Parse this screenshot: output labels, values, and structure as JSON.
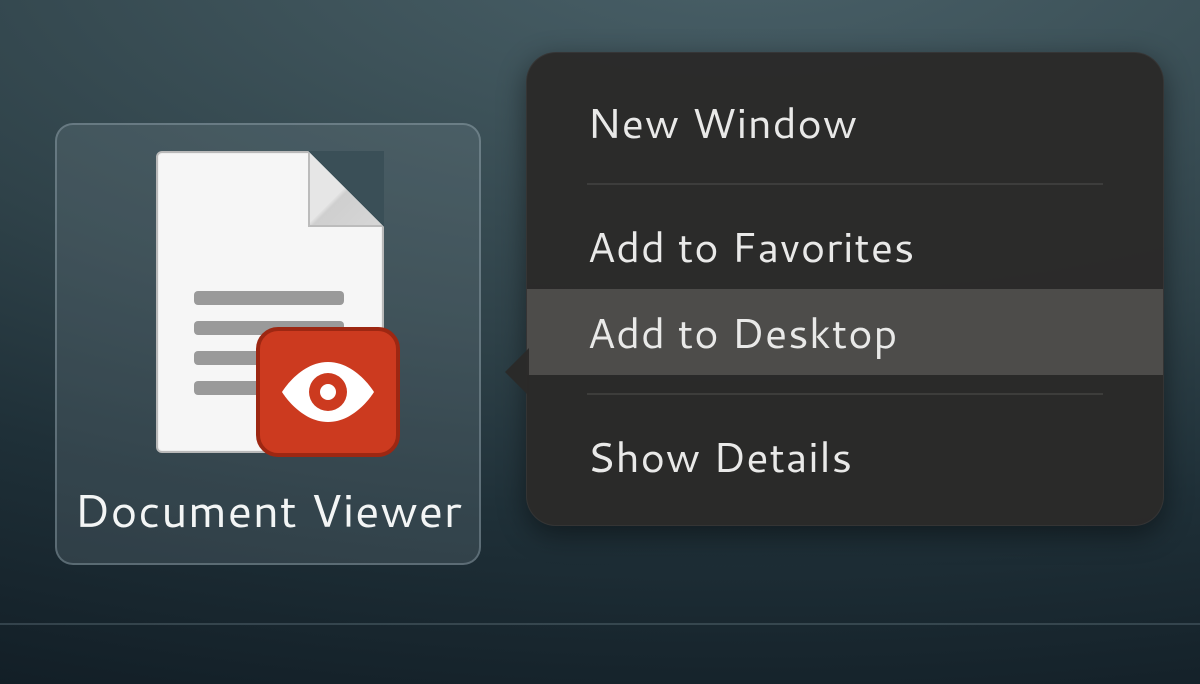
{
  "app": {
    "label": "Document Viewer",
    "icon_name": "document-viewer-icon"
  },
  "menu": {
    "items": [
      {
        "label": "New Window"
      },
      {
        "label": "Add to Favorites"
      },
      {
        "label": "Add to Desktop",
        "hovered": true
      },
      {
        "label": "Show Details"
      }
    ]
  }
}
